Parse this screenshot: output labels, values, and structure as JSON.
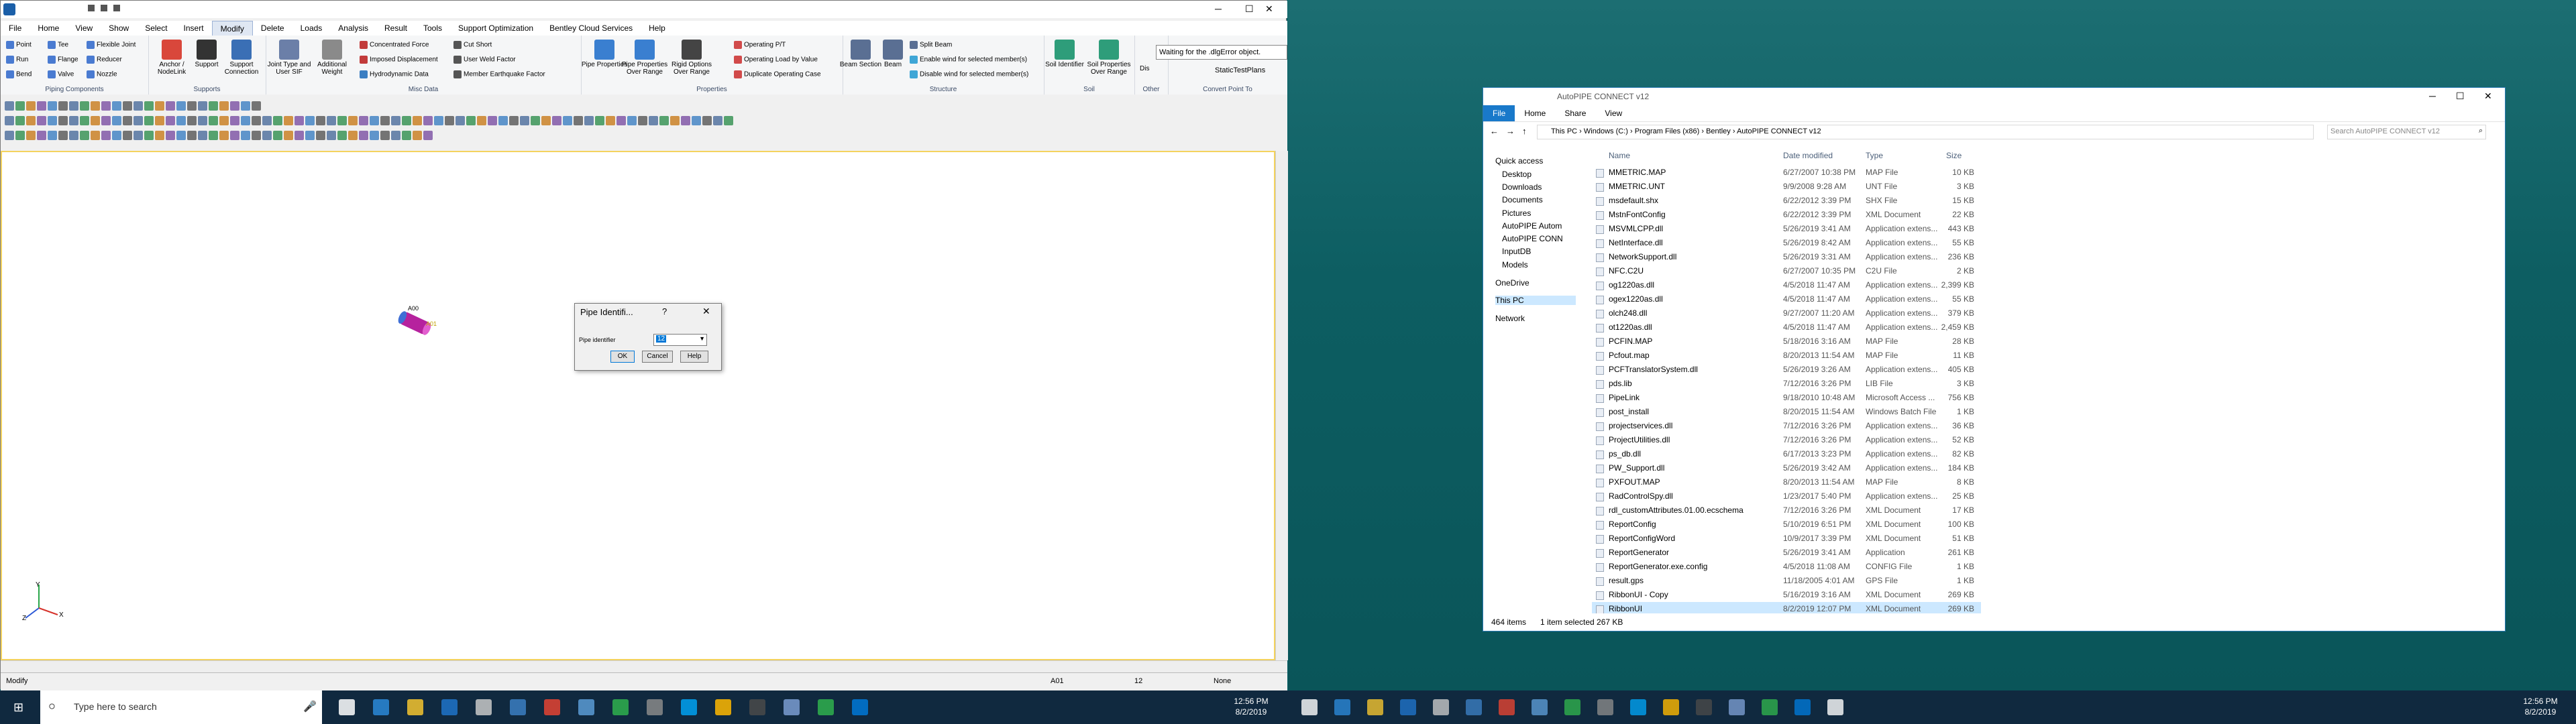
{
  "autopipe": {
    "title_tab": "Modify",
    "menu": [
      "File",
      "Home",
      "View",
      "Show",
      "Select",
      "Insert",
      "Modify",
      "Delete",
      "Loads",
      "Analysis",
      "Result",
      "Tools",
      "Support Optimization",
      "Bentley Cloud Services",
      "Help"
    ],
    "busy_message": "Waiting for the .dlgError object.",
    "static_plans": "StaticTestPlans",
    "ribbon": {
      "piping": {
        "label": "Piping Components",
        "items": [
          "Point",
          "Tee",
          "Flexible Joint",
          "Run",
          "Flange",
          "Reducer",
          "Bend",
          "Valve",
          "Nozzle"
        ]
      },
      "supports": {
        "label": "Supports",
        "items": [
          "Anchor / NodeLink",
          "Support",
          "Support Connection"
        ]
      },
      "misc": {
        "label": "Misc Data",
        "items": [
          "Joint Type and User SIF",
          "Additional Weight",
          "Concentrated Force",
          "Imposed Displacement",
          "Hydrodynamic Data",
          "Cut Short",
          "User Weld Factor",
          "Member Earthquake Factor"
        ]
      },
      "properties": {
        "label": "Properties",
        "items": [
          "Pipe Properties",
          "Pipe Properties Over Range",
          "Rigid Options Over Range",
          "Operating P/T",
          "Operating Load by Value",
          "Duplicate Operating Case"
        ]
      },
      "structure": {
        "label": "Structure",
        "items": [
          "Beam Section",
          "Beam",
          "Split Beam",
          "Enable wind for selected member(s)",
          "Disable wind for selected member(s)"
        ]
      },
      "soil": {
        "label": "Soil",
        "items": [
          "Soil Identifier",
          "Soil Properties Over Range"
        ]
      },
      "other": {
        "label": "Other",
        "items": [
          "Dis"
        ]
      },
      "convert": {
        "label": "Convert Point To"
      }
    },
    "model_node_labels": [
      "A00",
      "A01"
    ],
    "axis_labels": [
      "Y",
      "Z",
      "X"
    ],
    "status": {
      "mode": "Modify",
      "point": "A01",
      "value": "12",
      "snap": "None"
    },
    "dialog": {
      "title": "Pipe Identifi...",
      "help_glyph": "?",
      "close_glyph": "✕",
      "label": "Pipe identifier",
      "value": "12",
      "ok": "OK",
      "cancel": "Cancel",
      "help": "Help"
    }
  },
  "explorer": {
    "title": "AutoPIPE CONNECT v12",
    "tabs": [
      "File",
      "Home",
      "Share",
      "View"
    ],
    "breadcrumb": [
      "This PC",
      "Windows (C:)",
      "Program Files (x86)",
      "Bentley",
      "AutoPIPE CONNECT v12"
    ],
    "search_placeholder": "Search AutoPIPE CONNECT v12",
    "nav": [
      {
        "label": "Quick access"
      },
      {
        "label": "Desktop"
      },
      {
        "label": "Downloads"
      },
      {
        "label": "Documents"
      },
      {
        "label": "Pictures"
      },
      {
        "label": "AutoPIPE Autom"
      },
      {
        "label": "AutoPIPE CONN"
      },
      {
        "label": "InputDB"
      },
      {
        "label": "Models"
      },
      {
        "label": "OneDrive"
      },
      {
        "label": "This PC"
      },
      {
        "label": "Network"
      }
    ],
    "columns": [
      "Name",
      "Date modified",
      "Type",
      "Size"
    ],
    "files": [
      [
        "MMETRIC.MAP",
        "6/27/2007 10:38 PM",
        "MAP File",
        "10 KB"
      ],
      [
        "MMETRIC.UNT",
        "9/9/2008 9:28 AM",
        "UNT File",
        "3 KB"
      ],
      [
        "msdefault.shx",
        "6/22/2012 3:39 PM",
        "SHX File",
        "15 KB"
      ],
      [
        "MstnFontConfig",
        "6/22/2012 3:39 PM",
        "XML Document",
        "22 KB"
      ],
      [
        "MSVMLCPP.dll",
        "5/26/2019 3:41 AM",
        "Application extens...",
        "443 KB"
      ],
      [
        "NetInterface.dll",
        "5/26/2019 8:42 AM",
        "Application extens...",
        "55 KB"
      ],
      [
        "NetworkSupport.dll",
        "5/26/2019 3:31 AM",
        "Application extens...",
        "236 KB"
      ],
      [
        "NFC.C2U",
        "6/27/2007 10:35 PM",
        "C2U File",
        "2 KB"
      ],
      [
        "og1220as.dll",
        "4/5/2018 11:47 AM",
        "Application extens...",
        "2,399 KB"
      ],
      [
        "ogex1220as.dll",
        "4/5/2018 11:47 AM",
        "Application extens...",
        "55 KB"
      ],
      [
        "olch248.dll",
        "9/27/2007 11:20 AM",
        "Application extens...",
        "379 KB"
      ],
      [
        "ot1220as.dll",
        "4/5/2018 11:47 AM",
        "Application extens...",
        "2,459 KB"
      ],
      [
        "PCFIN.MAP",
        "5/18/2016 3:16 AM",
        "MAP File",
        "28 KB"
      ],
      [
        "Pcfout.map",
        "8/20/2013 11:54 AM",
        "MAP File",
        "11 KB"
      ],
      [
        "PCFTranslatorSystem.dll",
        "5/26/2019 3:26 AM",
        "Application extens...",
        "405 KB"
      ],
      [
        "pds.lib",
        "7/12/2016 3:26 PM",
        "LIB File",
        "3 KB"
      ],
      [
        "PipeLink",
        "9/18/2010 10:48 AM",
        "Microsoft Access ...",
        "756 KB"
      ],
      [
        "post_install",
        "8/20/2015 11:54 AM",
        "Windows Batch File",
        "1 KB"
      ],
      [
        "projectservices.dll",
        "7/12/2016 3:26 PM",
        "Application extens...",
        "36 KB"
      ],
      [
        "ProjectUtilities.dll",
        "7/12/2016 3:26 PM",
        "Application extens...",
        "52 KB"
      ],
      [
        "ps_db.dll",
        "6/17/2013 3:23 PM",
        "Application extens...",
        "82 KB"
      ],
      [
        "PW_Support.dll",
        "5/26/2019 3:42 AM",
        "Application extens...",
        "184 KB"
      ],
      [
        "PXFOUT.MAP",
        "8/20/2013 11:54 AM",
        "MAP File",
        "8 KB"
      ],
      [
        "RadControlSpy.dll",
        "1/23/2017 5:40 PM",
        "Application extens...",
        "25 KB"
      ],
      [
        "rdl_customAttributes.01.00.ecschema",
        "7/12/2016 3:26 PM",
        "XML Document",
        "17 KB"
      ],
      [
        "ReportConfig",
        "5/10/2019 6:51 PM",
        "XML Document",
        "100 KB"
      ],
      [
        "ReportConfigWord",
        "10/9/2017 3:39 PM",
        "XML Document",
        "51 KB"
      ],
      [
        "ReportGenerator",
        "5/26/2019 3:41 AM",
        "Application",
        "261 KB"
      ],
      [
        "ReportGenerator.exe.config",
        "4/5/2018 11:08 AM",
        "CONFIG File",
        "1 KB"
      ],
      [
        "result.gps",
        "11/18/2005 4:01 AM",
        "GPS File",
        "1 KB"
      ],
      [
        "RibbonUI - Copy",
        "5/16/2019 3:16 AM",
        "XML Document",
        "269 KB"
      ],
      [
        "RibbonUI",
        "8/2/2019 12:07 PM",
        "XML Document",
        "269 KB"
      ]
    ],
    "status": {
      "count": "464 items",
      "selection": "1 item selected  267 KB"
    }
  },
  "taskbar": {
    "search_placeholder": "Type here to search",
    "time": "12:56 PM",
    "date": "8/2/2019"
  },
  "colors": {
    "accent": "#1979ca",
    "taskbar": "#10293f",
    "workspace_border": "#f4d35e"
  }
}
